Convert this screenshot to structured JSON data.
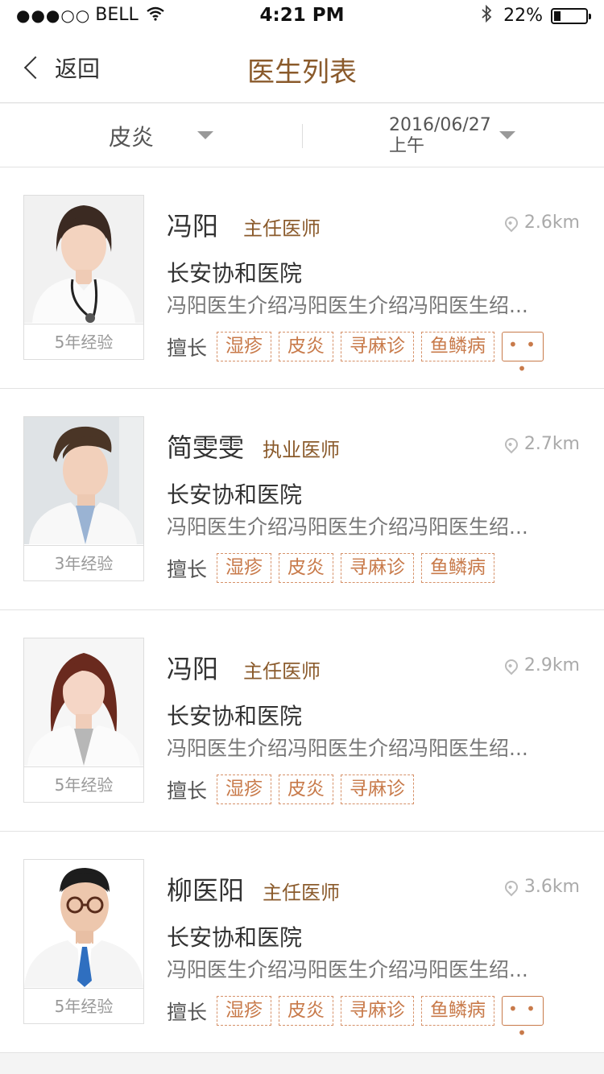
{
  "status_bar": {
    "signal": "●●●○○",
    "carrier": "BELL",
    "time": "4:21 PM",
    "battery_percent": "22%",
    "battery_level": 0.22
  },
  "nav": {
    "back_label": "返回",
    "title": "医生列表"
  },
  "filters": {
    "condition": "皮炎",
    "date": "2016/06/27",
    "period": "上午"
  },
  "colors": {
    "accent": "#8a5a2b",
    "tag": "#c87a4a"
  },
  "doctors": [
    {
      "name": "冯阳",
      "title": "主任医师",
      "distance": "2.6km",
      "hospital": "长安协和医院",
      "intro": "冯阳医生介绍冯阳医生介绍冯阳医生绍...",
      "experience": "5年经验",
      "skills_label": "擅长",
      "tags": [
        "湿疹",
        "皮炎",
        "寻麻诊",
        "鱼鳞病"
      ],
      "more": "• • •"
    },
    {
      "name": "简雯雯",
      "title": "执业医师",
      "distance": "2.7km",
      "hospital": "长安协和医院",
      "intro": "冯阳医生介绍冯阳医生介绍冯阳医生绍...",
      "experience": "3年经验",
      "skills_label": "擅长",
      "tags": [
        "湿疹",
        "皮炎",
        "寻麻诊",
        "鱼鳞病"
      ]
    },
    {
      "name": "冯阳",
      "title": "主任医师",
      "distance": "2.9km",
      "hospital": "长安协和医院",
      "intro": "冯阳医生介绍冯阳医生介绍冯阳医生绍...",
      "experience": "5年经验",
      "skills_label": "擅长",
      "tags": [
        "湿疹",
        "皮炎",
        "寻麻诊"
      ]
    },
    {
      "name": "柳医阳",
      "title": "主任医师",
      "distance": "3.6km",
      "hospital": "长安协和医院",
      "intro": "冯阳医生介绍冯阳医生介绍冯阳医生绍...",
      "experience": "5年经验",
      "skills_label": "擅长",
      "tags": [
        "湿疹",
        "皮炎",
        "寻麻诊",
        "鱼鳞病"
      ],
      "more": "• • •"
    }
  ]
}
